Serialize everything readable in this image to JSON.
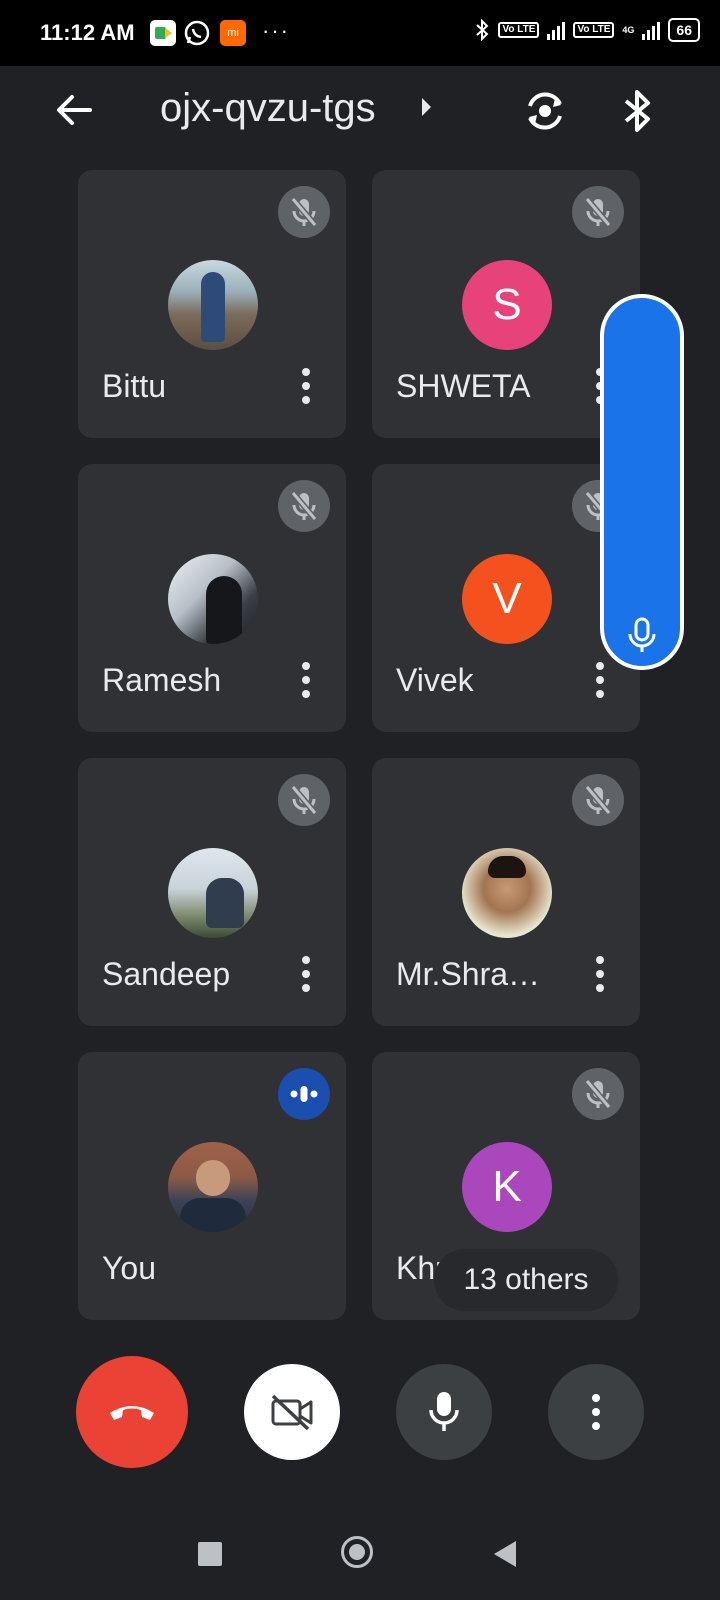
{
  "status_bar": {
    "time": "11:12 AM",
    "notification_icons": [
      "google-meet-icon",
      "whatsapp-icon",
      "mi-icon"
    ],
    "mi_label": "mi",
    "overflow": "···",
    "sim1_label": "Vo LTE",
    "sim2_label": "Vo LTE",
    "network_label": "4G",
    "battery": "66"
  },
  "header": {
    "meeting_code": "ojx-qvzu-tgs",
    "icons": [
      "back-arrow-icon",
      "switch-camera-icon",
      "bluetooth-icon"
    ]
  },
  "participants": [
    {
      "name": "Bittu",
      "avatar_type": "photo",
      "muted": true
    },
    {
      "name": "SHWETA",
      "avatar_type": "letter",
      "letter": "S",
      "color": "#e8427a",
      "muted": true
    },
    {
      "name": "Ramesh",
      "avatar_type": "photo",
      "muted": true
    },
    {
      "name": "Vivek",
      "avatar_type": "letter",
      "letter": "V",
      "color": "#f4511e",
      "muted": true
    },
    {
      "name": "Sandeep",
      "avatar_type": "photo",
      "muted": true
    },
    {
      "name": "Mr.Shra…",
      "avatar_type": "photo",
      "muted": true
    },
    {
      "name": "You",
      "avatar_type": "photo",
      "muted": false,
      "speaking": true
    },
    {
      "name": "Khushboo",
      "visible_name": "Khus",
      "avatar_type": "letter",
      "letter": "K",
      "color": "#ab47bc",
      "muted": true
    }
  ],
  "others_label": "13 others",
  "controls": {
    "end_call_color": "#ea4335",
    "camera": "camera-off-icon",
    "mic": "mic-icon",
    "more": "more-vert-icon"
  },
  "accent_color": "#1a73e8"
}
